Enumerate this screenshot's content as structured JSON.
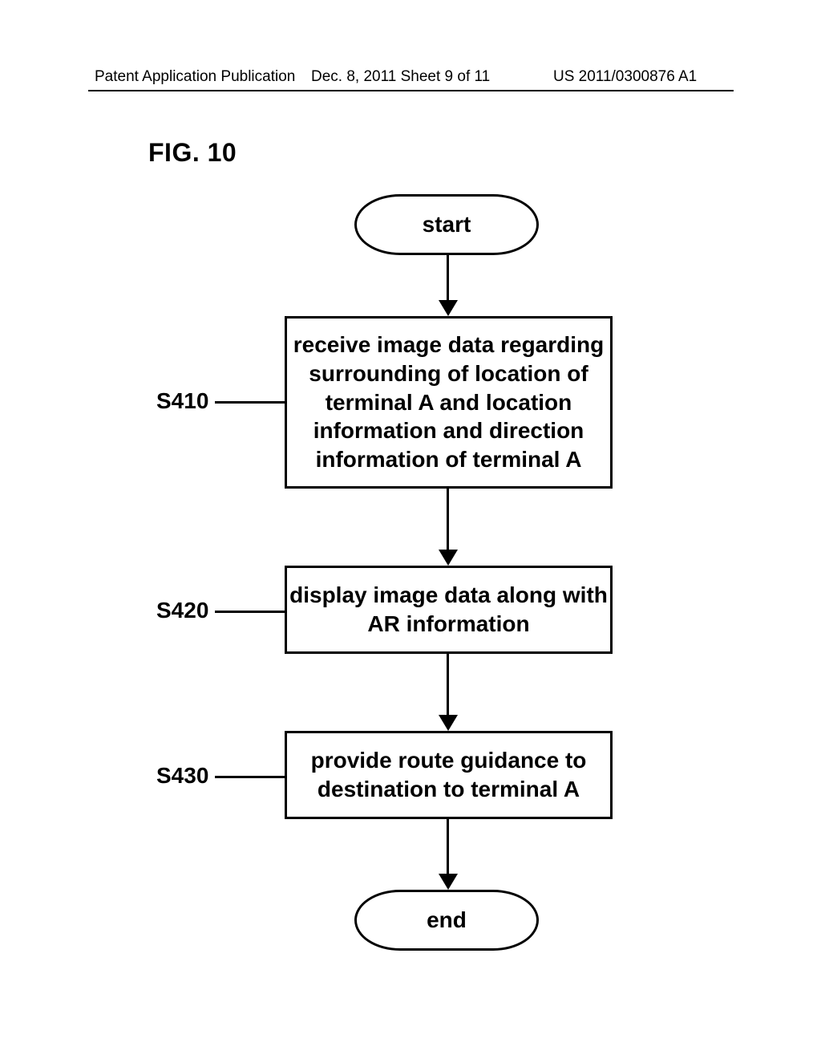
{
  "header": {
    "publication_type": "Patent Application Publication",
    "date_sheet": "Dec. 8, 2011  Sheet 9 of 11",
    "pub_number": "US 2011/0300876 A1"
  },
  "figure_label": "FIG. 10",
  "terminals": {
    "start": "start",
    "end": "end"
  },
  "steps": {
    "s410": {
      "label": "S410",
      "text": "receive image data regarding surrounding of location of terminal A and location information and direction information of terminal A"
    },
    "s420": {
      "label": "S420",
      "text": "display image data along with AR information"
    },
    "s430": {
      "label": "S430",
      "text": "provide route guidance to destination to terminal A"
    }
  }
}
